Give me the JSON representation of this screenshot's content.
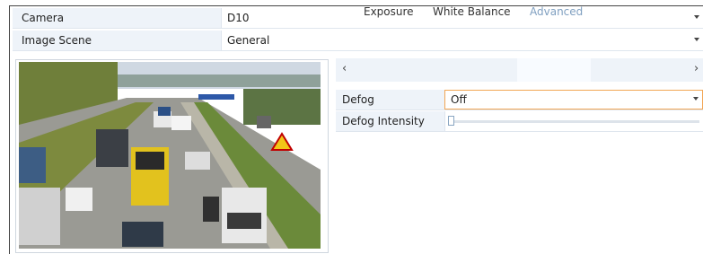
{
  "camera": {
    "label": "Camera",
    "value": "D10"
  },
  "image_scene": {
    "label": "Image Scene",
    "value": "General"
  },
  "tabs": [
    {
      "label": "Exposure",
      "active": false
    },
    {
      "label": "White Balance",
      "active": false
    },
    {
      "label": "Advanced",
      "active": true
    }
  ],
  "defog": {
    "label": "Defog",
    "value": "Off"
  },
  "defog_intensity": {
    "label": "Defog Intensity",
    "level": 0
  },
  "colors": {
    "accent": "#7f9fc0",
    "focus_border": "#f2a654",
    "row_bg": "#eef3f9"
  },
  "icons": {
    "prev": "chevron-left-icon",
    "next": "chevron-right-icon",
    "dropdown": "caret-down-icon"
  }
}
